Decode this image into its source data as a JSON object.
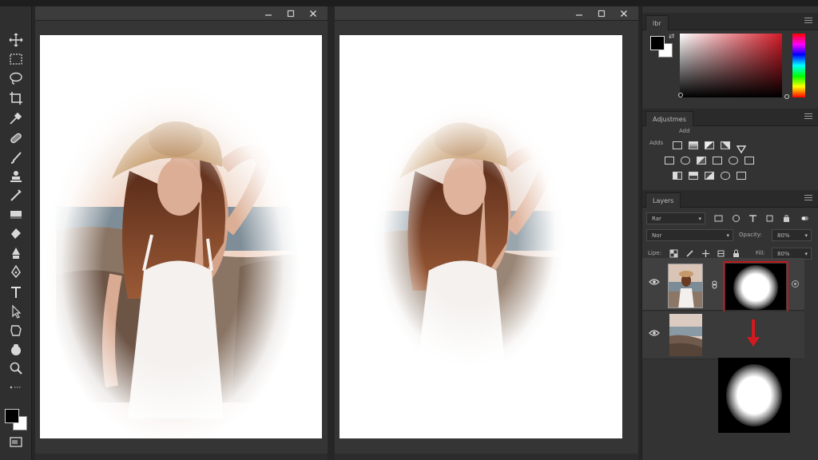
{
  "colors": {
    "workspace": "#262626",
    "panel": "#333333",
    "accent_red": "#c0171c",
    "canvas": "#ffffff"
  },
  "toolbar": {
    "tools": [
      {
        "name": "move-tool-icon"
      },
      {
        "name": "marquee-tool-icon"
      },
      {
        "name": "lasso-tool-icon"
      },
      {
        "name": "crop-tool-icon"
      },
      {
        "name": "eyedropper-tool-icon"
      },
      {
        "name": "healing-brush-tool-icon"
      },
      {
        "name": "brush-tool-icon"
      },
      {
        "name": "clone-stamp-tool-icon"
      },
      {
        "name": "history-brush-tool-icon"
      },
      {
        "name": "eraser-tool-icon"
      },
      {
        "name": "paint-bucket-tool-icon"
      },
      {
        "name": "dodge-tool-icon"
      },
      {
        "name": "pen-tool-icon"
      },
      {
        "name": "type-tool-icon"
      },
      {
        "name": "path-selection-tool-icon"
      },
      {
        "name": "shape-tool-icon"
      },
      {
        "name": "hand-tool-icon"
      },
      {
        "name": "zoom-tool-icon"
      }
    ]
  },
  "color_panel": {
    "tab_label": "lbr"
  },
  "adjustments_panel": {
    "tab_label": "Adjustmes",
    "subtitle": "Add",
    "row_label": "Adds"
  },
  "layers_panel": {
    "tab_label": "Layers",
    "kind_filter": "Rar",
    "blend_mode": "Nor",
    "opacity_label": "Opacity:",
    "opacity_value": "80%",
    "lock_label": "Lipe:",
    "fill_label": "Fill:",
    "fill_value": "80%",
    "layers": [
      {
        "name": "woman-layer",
        "has_mask": true
      },
      {
        "name": "background-layer",
        "has_mask": false
      }
    ]
  }
}
